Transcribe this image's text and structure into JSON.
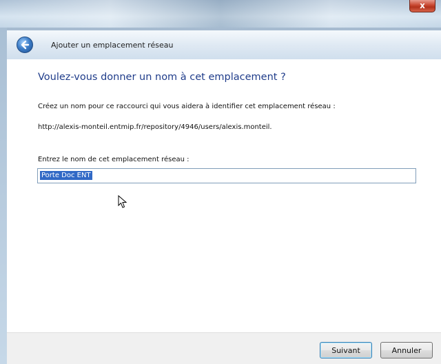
{
  "window": {
    "close_glyph": "x"
  },
  "nav": {
    "title": "Ajouter un emplacement réseau",
    "back_icon": "back-arrow-icon"
  },
  "content": {
    "heading": "Voulez-vous donner un nom à cet emplacement ?",
    "description": "Créez un nom pour ce raccourci qui vous aidera à identifier cet emplacement réseau :",
    "url": "http://alexis-monteil.entmip.fr/repository/4946/users/alexis.monteil.",
    "field_label": "Entrez le nom de cet emplacement réseau :",
    "field_value": "Porte Doc ENT"
  },
  "buttons": {
    "next": "Suivant",
    "cancel": "Annuler"
  },
  "colors": {
    "heading": "#1f3c8a",
    "selection": "#3169c6",
    "close_button": "#c8462f"
  }
}
